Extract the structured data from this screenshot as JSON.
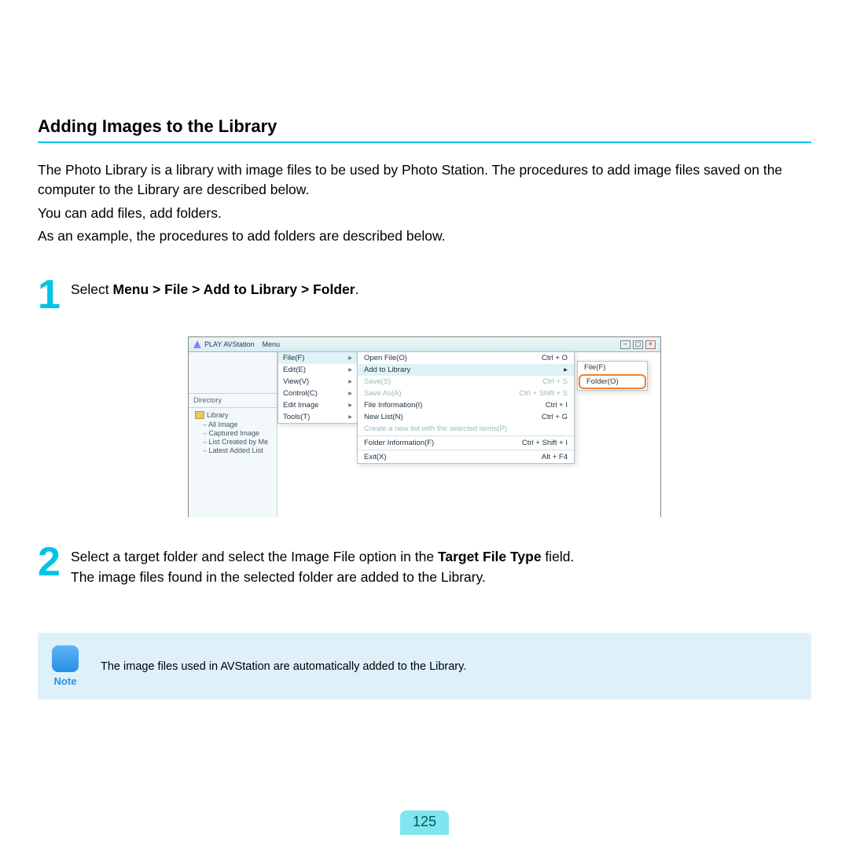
{
  "title": "Adding Images to the Library",
  "intro": {
    "p1": "The Photo Library is a library with image files to be used by Photo Station. The procedures to add image files saved on the computer to the Library are described below.",
    "p2": "You can add files, add folders.",
    "p3": "As an example, the procedures to add folders are described below."
  },
  "step1": {
    "num": "1",
    "lead": "Select ",
    "bold": "Menu > File > Add to Library > Folder",
    "tail": "."
  },
  "step2": {
    "num": "2",
    "line1a": "Select a target folder and select the Image File option in the ",
    "line1b": "Target File Type",
    "line1c": " field.",
    "line2": "The image files found in the selected folder are added to the Library."
  },
  "note": {
    "label": "Note",
    "text": "The image files used in AVStation are automatically added to the Library."
  },
  "pagenum": "125",
  "screenshot": {
    "app_title": "PLAY AVStation",
    "menu_label": "Menu",
    "sidebar": {
      "directory": "Directory",
      "root": "Library",
      "items": [
        "All Image",
        "Captured Image",
        "List Created by Me",
        "Latest Added List"
      ]
    },
    "menu1": [
      {
        "label": "File(F)",
        "arrow": "▸"
      },
      {
        "label": "Edit(E)",
        "arrow": "▸"
      },
      {
        "label": "View(V)",
        "arrow": "▸"
      },
      {
        "label": "Control(C)",
        "arrow": "▸"
      },
      {
        "label": "Edit Image",
        "arrow": "▸"
      },
      {
        "label": "Tools(T)",
        "arrow": "▸"
      }
    ],
    "menu2": [
      {
        "label": "Open File(O)",
        "shortcut": "Ctrl + O",
        "hl": false
      },
      {
        "label": "Add to Library",
        "shortcut": "▸",
        "hl": true
      },
      {
        "label": "Save(S)",
        "shortcut": "Ctrl + S",
        "dis": true
      },
      {
        "label": "Save As(A)",
        "shortcut": "Ctrl + Shift + S",
        "dis": true
      },
      {
        "label": "File Information(I)",
        "shortcut": "Ctrl + I"
      },
      {
        "label": "New List(N)",
        "shortcut": "Ctrl + G"
      },
      {
        "label": "Create a new list with the selected items(P)",
        "shortcut": "",
        "dis": true
      },
      {
        "label": "Folder Information(F)",
        "shortcut": "Ctrl + Shift + I"
      },
      {
        "label": "Exit(X)",
        "shortcut": "Alt + F4"
      }
    ],
    "submenu": [
      {
        "label": "File(F)",
        "hl": false
      },
      {
        "label": "Folder(O)",
        "hl": true
      }
    ]
  }
}
